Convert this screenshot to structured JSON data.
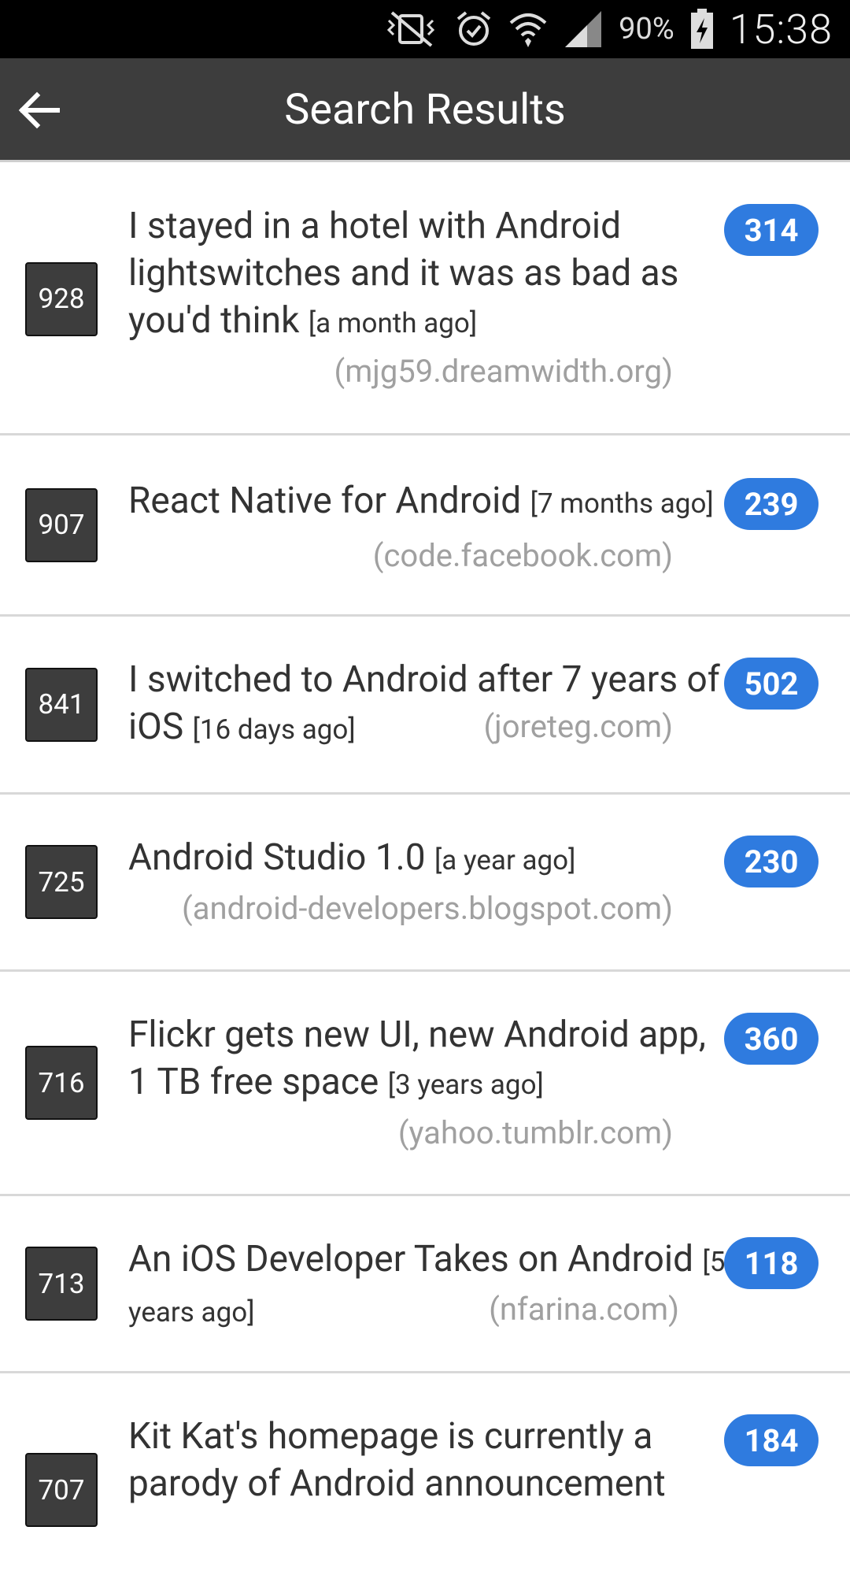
{
  "status_bar": {
    "battery_percent": "90%",
    "time": "15:38",
    "icons": [
      "vibrate-off-icon",
      "alarm-icon",
      "wifi-icon",
      "cell-signal-icon",
      "battery-charging-icon"
    ]
  },
  "app_bar": {
    "title": "Search Results",
    "back_icon": "arrow-back-icon"
  },
  "results": [
    {
      "rank": "928",
      "title": "I stayed in a hotel with Android lightswitches and it was as bad as you'd think",
      "age": "[a month ago]",
      "domain": "(mjg59.dreamwidth.org)",
      "comments": "314"
    },
    {
      "rank": "907",
      "title": "React Native for Android",
      "age": "[7 months ago]",
      "domain": "(code.facebook.com)",
      "comments": "239"
    },
    {
      "rank": "841",
      "title": "I switched to Android after 7 years of iOS",
      "age": "[16 days ago]",
      "domain": "(joreteg.com)",
      "comments": "502"
    },
    {
      "rank": "725",
      "title": "Android Studio 1.0",
      "age": "[a year ago]",
      "domain": "(android-developers.blogspot.com)",
      "comments": "230"
    },
    {
      "rank": "716",
      "title": "Flickr gets new UI, new Android app, 1 TB free space",
      "age": "[3 years ago]",
      "domain": "(yahoo.tumblr.com)",
      "comments": "360"
    },
    {
      "rank": "713",
      "title": "An iOS Developer Takes on Android",
      "age": "[5 years ago]",
      "domain": "(nfarina.com)",
      "comments": "118"
    },
    {
      "rank": "707",
      "title": "Kit Kat's homepage is currently a parody of Android announcement",
      "age": "",
      "domain": "",
      "comments": "184"
    }
  ]
}
